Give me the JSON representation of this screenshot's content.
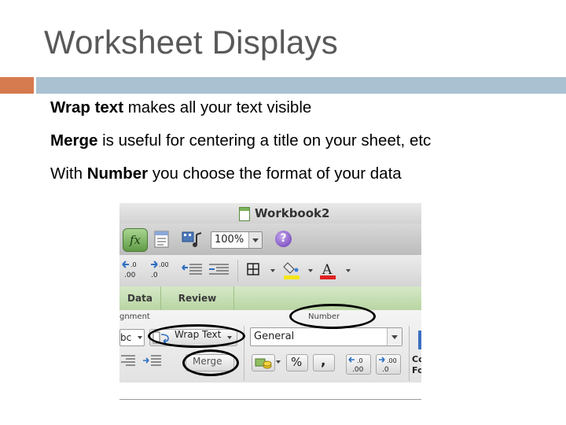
{
  "slide": {
    "title": "Worksheet Displays",
    "bullets": [
      {
        "prefix": "",
        "bold": "Wrap text",
        "suffix": " makes all your text visible"
      },
      {
        "prefix": "",
        "bold": "Merge",
        "suffix": " is useful for centering a  title on your sheet, etc"
      },
      {
        "prefix": "With ",
        "bold": "Number",
        "suffix": " you choose the format of your data"
      }
    ],
    "colors": {
      "accent_orange": "#d67a4f",
      "accent_blue": "#a9c1d1",
      "title": "#595959"
    }
  },
  "screenshot": {
    "window_title": "Workbook2",
    "toolbar": {
      "fx_label": "fx",
      "zoom_value": "100%",
      "help_label": "?"
    },
    "format_row": {
      "decimal_labels": [
        ".0",
        ".00",
        ".0",
        ".00"
      ],
      "font_color_letter": "A"
    },
    "tabs": [
      {
        "label": "Data"
      },
      {
        "label": "Review"
      }
    ],
    "ribbon": {
      "alignment_group_label": "gnment",
      "number_group_label": "Number",
      "font_partial_value": "bc",
      "wrap_text_label": "Wrap Text",
      "merge_label": "Merge",
      "number_format_value": "General",
      "percent_label": "%",
      "comma_label": ",",
      "decimal_labels": [
        ".0",
        ".00",
        ".00",
        ".0"
      ],
      "cond_format_partial": [
        "Co",
        "Fo"
      ]
    },
    "icons": [
      "fx-icon",
      "table-icon",
      "media-icon",
      "help-icon",
      "borders-icon",
      "fill-color-icon",
      "font-color-icon",
      "wrap-text-icon",
      "currency-icon"
    ],
    "colors": {
      "tab_bar": "#c6dfb2",
      "fx_button": "#7db862",
      "help": "#7a48c4",
      "highlight_circle": "#000000"
    }
  }
}
